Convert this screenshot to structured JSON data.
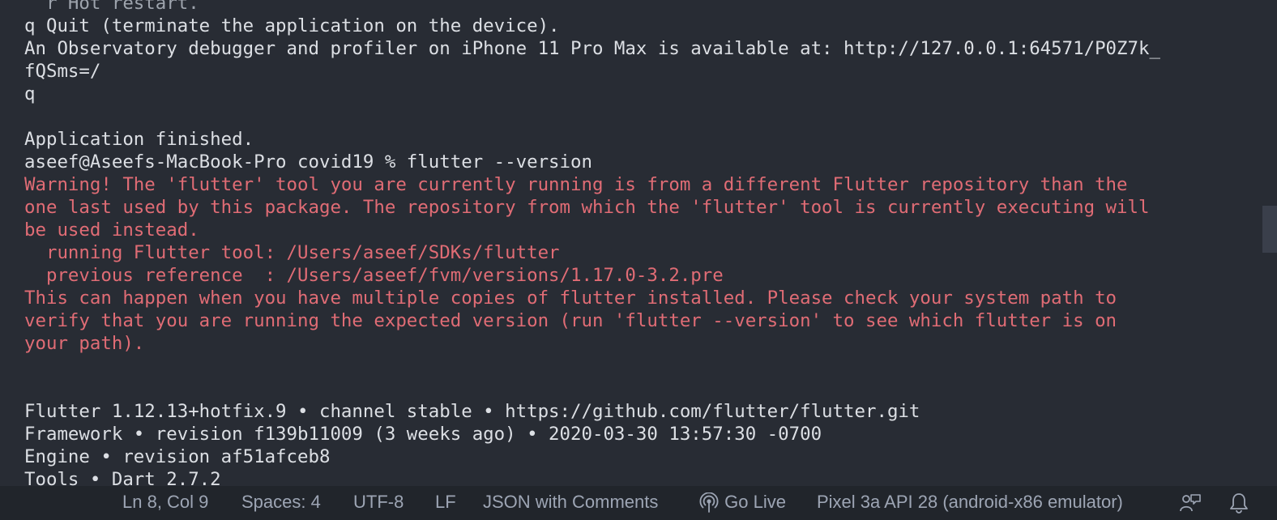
{
  "terminal": {
    "lines": [
      {
        "text": "  r Hot restart.",
        "type": "cut"
      },
      {
        "text": "q Quit (terminate the application on the device).",
        "type": "normal"
      },
      {
        "text": "An Observatory debugger and profiler on iPhone 11 Pro Max is available at: http://127.0.0.1:64571/P0Z7k_",
        "type": "normal"
      },
      {
        "text": "fQSms=/",
        "type": "normal"
      },
      {
        "text": "q",
        "type": "normal"
      },
      {
        "text": "",
        "type": "normal"
      },
      {
        "text": "Application finished.",
        "type": "normal"
      },
      {
        "text": "aseef@Aseefs-MacBook-Pro covid19 % flutter --version",
        "type": "normal"
      },
      {
        "text": "Warning! The 'flutter' tool you are currently running is from a different Flutter repository than the",
        "type": "error"
      },
      {
        "text": "one last used by this package. The repository from which the 'flutter' tool is currently executing will",
        "type": "error"
      },
      {
        "text": "be used instead.",
        "type": "error"
      },
      {
        "text": "  running Flutter tool: /Users/aseef/SDKs/flutter",
        "type": "error"
      },
      {
        "text": "  previous reference  : /Users/aseef/fvm/versions/1.17.0-3.2.pre",
        "type": "error"
      },
      {
        "text": "This can happen when you have multiple copies of flutter installed. Please check your system path to",
        "type": "error"
      },
      {
        "text": "verify that you are running the expected version (run 'flutter --version' to see which flutter is on",
        "type": "error"
      },
      {
        "text": "your path).",
        "type": "error"
      },
      {
        "text": "",
        "type": "normal"
      },
      {
        "text": "",
        "type": "normal"
      },
      {
        "text": "Flutter 1.12.13+hotfix.9 • channel stable • https://github.com/flutter/flutter.git",
        "type": "normal"
      },
      {
        "text": "Framework • revision f139b11009 (3 weeks ago) • 2020-03-30 13:57:30 -0700",
        "type": "normal"
      },
      {
        "text": "Engine • revision af51afceb8",
        "type": "normal"
      },
      {
        "text": "Tools • Dart 2.7.2",
        "type": "normal"
      }
    ]
  },
  "statusbar": {
    "cursor_position": "Ln 8, Col 9",
    "indentation": "Spaces: 4",
    "encoding": "UTF-8",
    "line_ending": "LF",
    "language_mode": "JSON with Comments",
    "go_live": "Go Live",
    "go_live_icon": "broadcast-icon",
    "device": "Pixel 3a API 28 (android-x86 emulator)",
    "feedback_icon": "feedback-icon",
    "notifications_icon": "bell-icon"
  },
  "colors": {
    "background": "#282c34",
    "text": "#dcdfe4",
    "error": "#e06c75",
    "statusbar_bg": "#21252b",
    "statusbar_text": "#9da5b4"
  }
}
